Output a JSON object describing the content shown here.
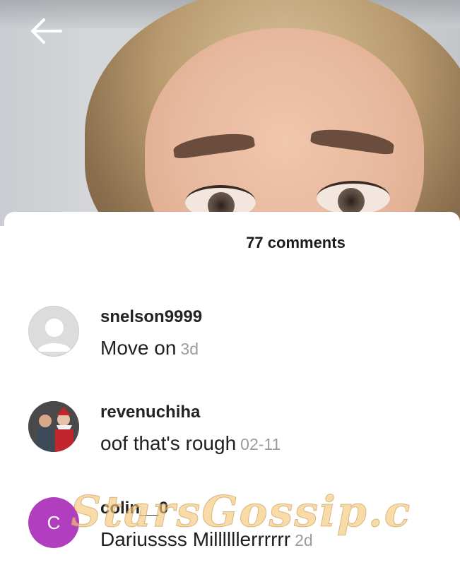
{
  "header": {
    "back_icon": "arrow-left-icon"
  },
  "comments_panel": {
    "count_label": "77 comments",
    "comments": [
      {
        "username": "snelson9999",
        "text": "Move on",
        "time": "3d",
        "avatar": "default-user-icon"
      },
      {
        "username": "revenuchiha",
        "text": "oof that's rough",
        "time": "02-11",
        "avatar": "photo"
      },
      {
        "username": "colin__0",
        "text": "Dariussss Millllllerrrrrr",
        "time": "2d",
        "avatar_letter": "C",
        "avatar_color": "#b13dbf"
      }
    ]
  },
  "watermark": {
    "text": "StarsGossip.c"
  }
}
